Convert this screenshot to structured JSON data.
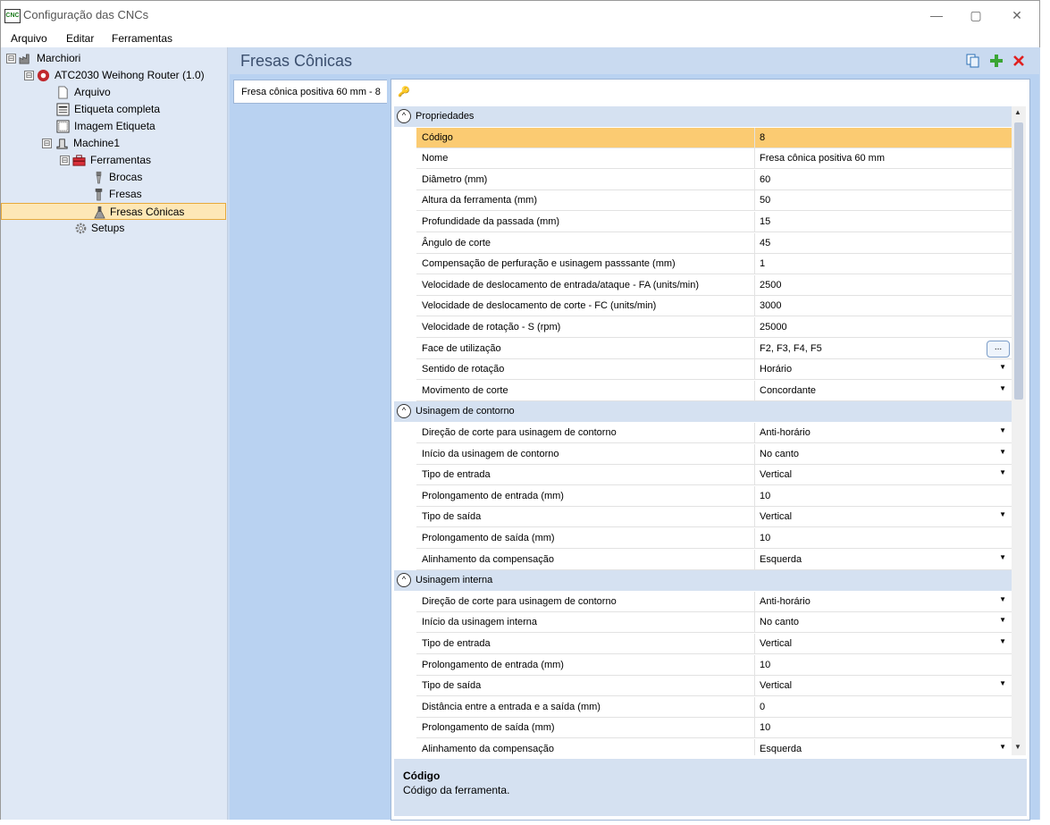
{
  "window": {
    "title": "Configuração das CNCs",
    "app_icon_text": "CNC",
    "minimize_glyph": "—",
    "maximize_glyph": "▢",
    "close_glyph": "✕"
  },
  "menu": {
    "file": "Arquivo",
    "edit": "Editar",
    "tools": "Ferramentas"
  },
  "tree": {
    "root": {
      "label": "Marchiori",
      "expander": "⊟"
    },
    "machine": {
      "label": "ATC2030 Weihong Router (1.0)",
      "expander": "⊟"
    },
    "arquivo": {
      "label": "Arquivo"
    },
    "etiqueta_completa": {
      "label": "Etiqueta completa"
    },
    "imagem_etiqueta": {
      "label": "Imagem Etiqueta"
    },
    "machine1": {
      "label": "Machine1",
      "expander": "⊟"
    },
    "ferramentas": {
      "label": "Ferramentas",
      "expander": "⊟"
    },
    "brocas": {
      "label": "Brocas"
    },
    "fresas": {
      "label": "Fresas"
    },
    "fresas_conicas": {
      "label": "Fresas Cônicas"
    },
    "setups": {
      "label": "Setups"
    }
  },
  "panel": {
    "title": "Fresas Cônicas",
    "tab_label": "Fresa cônica positiva 60 mm - 8"
  },
  "categories": {
    "propriedades": "Propriedades",
    "contorno": "Usinagem de contorno",
    "interna": "Usinagem interna",
    "toggle_glyph": "^"
  },
  "props": [
    {
      "name": "Código",
      "value": "8"
    },
    {
      "name": "Nome",
      "value": "Fresa cônica positiva 60 mm"
    },
    {
      "name": "Diâmetro (mm)",
      "value": "60"
    },
    {
      "name": "Altura da ferramenta (mm)",
      "value": "50"
    },
    {
      "name": "Profundidade da passada (mm)",
      "value": "15"
    },
    {
      "name": "Ângulo de corte",
      "value": "45"
    },
    {
      "name": "Compensação de perfuração e usinagem passsante (mm)",
      "value": "1"
    },
    {
      "name": "Velocidade de deslocamento de entrada/ataque - FA (units/min)",
      "value": "2500"
    },
    {
      "name": "Velocidade de deslocamento de corte - FC (units/min)",
      "value": "3000"
    },
    {
      "name": "Velocidade de rotação - S (rpm)",
      "value": "25000"
    },
    {
      "name": "Face de utilização",
      "value": "F2, F3, F4, F5"
    },
    {
      "name": "Sentido de rotação",
      "value": "Horário"
    },
    {
      "name": "Movimento de corte",
      "value": "Concordante"
    }
  ],
  "contorno": [
    {
      "name": "Direção de corte para usinagem de contorno",
      "value": "Anti-horário"
    },
    {
      "name": "Início da usinagem de contorno",
      "value": "No canto"
    },
    {
      "name": "Tipo de entrada",
      "value": "Vertical"
    },
    {
      "name": "Prolongamento de entrada (mm)",
      "value": "10"
    },
    {
      "name": "Tipo de saída",
      "value": "Vertical"
    },
    {
      "name": "Prolongamento de saída (mm)",
      "value": "10"
    },
    {
      "name": "Alinhamento da compensação",
      "value": "Esquerda"
    }
  ],
  "interna": [
    {
      "name": "Direção de corte para usinagem de contorno",
      "value": "Anti-horário"
    },
    {
      "name": "Início da usinagem interna",
      "value": "No canto"
    },
    {
      "name": "Tipo de entrada",
      "value": "Vertical"
    },
    {
      "name": "Prolongamento de entrada (mm)",
      "value": "10"
    },
    {
      "name": "Tipo de saída",
      "value": "Vertical"
    },
    {
      "name": "Distância entre a entrada e a saída (mm)",
      "value": "0"
    },
    {
      "name": "Prolongamento de saída (mm)",
      "value": "10"
    },
    {
      "name": "Alinhamento da compensação",
      "value": "Esquerda"
    }
  ],
  "glyphs": {
    "dropdown": "▼",
    "ellipsis": "...",
    "scroll_up": "▲",
    "scroll_down": "▼",
    "key": "🔑"
  },
  "description": {
    "title": "Código",
    "text": "Código da ferramenta."
  },
  "colors": {
    "selected_row": "#fbcb72",
    "tree_bg": "#dfe8f5",
    "panel_bg": "#c9daf0",
    "add_icon": "#3aa534",
    "delete_icon": "#e02020"
  }
}
